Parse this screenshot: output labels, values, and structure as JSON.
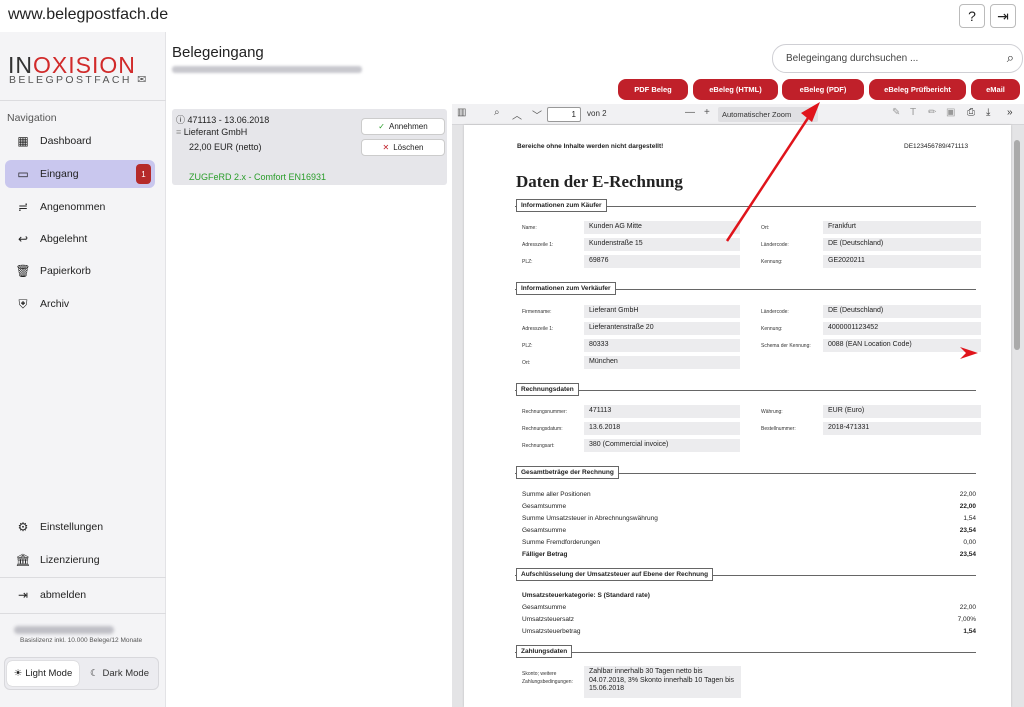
{
  "browser": {
    "url": "www.belegpostfach.de",
    "help_label": "?",
    "exit_label": "⇥"
  },
  "logo": {
    "line1_part1": "IN",
    "line1_part2": "OXISION",
    "line2": "BELEGPOSTFACH"
  },
  "sidebar": {
    "heading": "Navigation",
    "items": [
      {
        "label": "Dashboard",
        "icon": "dashboard-icon"
      },
      {
        "label": "Eingang",
        "icon": "inbox-icon",
        "badge": "1"
      },
      {
        "label": "Angenommen",
        "icon": "accepted-icon"
      },
      {
        "label": "Abgelehnt",
        "icon": "reply-icon"
      },
      {
        "label": "Papierkorb",
        "icon": "trash-icon"
      },
      {
        "label": "Archiv",
        "icon": "shield-icon"
      }
    ],
    "settings": "Einstellungen",
    "licensing": "Lizenzierung",
    "logout": "abmelden",
    "license_text": "Basislizenz inkl. 10.000 Belege/12 Monate",
    "light_mode": "Light Mode",
    "dark_mode": "Dark Mode"
  },
  "header": {
    "title": "Belegeingang",
    "search_placeholder": "Belegeingang durchsuchen ..."
  },
  "actions": [
    "PDF Beleg",
    "eBeleg (HTML)",
    "eBeleg (PDF)",
    "eBeleg Prüfbericht",
    "eMail"
  ],
  "document_item": {
    "id_date": "471113 - 13.06.2018",
    "sender": "Lieferant GmbH",
    "amount": "22,00 EUR (netto)",
    "format": "ZUGFeRD 2.x - Comfort EN16931",
    "accept": "Annehmen",
    "delete": "Löschen"
  },
  "viewer": {
    "page": "1",
    "of": "von 2",
    "zoom": "Automatischer Zoom"
  },
  "pdf": {
    "notice": "Bereiche ohne Inhalte werden nicht dargestellt!",
    "doc_id": "DE123456789/471113",
    "title": "Daten der E-Rechnung",
    "buyer": {
      "heading": "Informationen zum Käufer",
      "name_l": "Name:",
      "name": "Kunden AG Mitte",
      "addr_l": "Adresszeile 1:",
      "addr": "Kundenstraße 15",
      "plz_l": "PLZ:",
      "plz": "69876",
      "city_l": "Ort:",
      "city": "Frankfurt",
      "country_l": "Ländercode:",
      "country": "DE (Deutschland)",
      "id_l": "Kennung:",
      "id": "GE2020211"
    },
    "seller": {
      "heading": "Informationen zum Verkäufer",
      "name_l": "Firmenname:",
      "name": "Lieferant GmbH",
      "addr_l": "Adresszeile 1:",
      "addr": "Lieferantenstraße 20",
      "plz_l": "PLZ:",
      "plz": "80333",
      "city_l": "Ort:",
      "city": "München",
      "country_l": "Ländercode:",
      "country": "DE (Deutschland)",
      "id_l": "Kennung:",
      "id": "4000001123452",
      "scheme_l": "Schema der Kennung:",
      "scheme": "0088 (EAN Location Code)"
    },
    "invoice": {
      "heading": "Rechnungsdaten",
      "num_l": "Rechnungsnummer:",
      "num": "471113",
      "date_l": "Rechnungsdatum:",
      "date": "13.6.2018",
      "type_l": "Rechnungsart:",
      "type": "380 (Commercial invoice)",
      "cur_l": "Währung:",
      "cur": "EUR (Euro)",
      "order_l": "Bestellnummer:",
      "order": "2018-471331"
    },
    "totals": {
      "heading": "Gesamtbeträge der Rechnung",
      "rows": [
        {
          "l": "Summe aller Positionen",
          "v": "22,00",
          "b": false
        },
        {
          "l": "Gesamtsumme",
          "v": "22,00",
          "b": true
        },
        {
          "l": "Summe Umsatzsteuer in Abrechnungswährung",
          "v": "1,54",
          "b": false
        },
        {
          "l": "Gesamtsumme",
          "v": "23,54",
          "b": true
        },
        {
          "l": "Summe Fremdforderungen",
          "v": "0,00",
          "b": false
        },
        {
          "l": "Fälliger Betrag",
          "v": "23,54",
          "b": true
        }
      ]
    },
    "vat": {
      "heading": "Aufschlüsselung der Umsatzsteuer auf Ebene der Rechnung",
      "category": "Umsatzsteuerkategorie: S (Standard rate)",
      "rows": [
        {
          "l": "Gesamtsumme",
          "v": "22,00",
          "b": false
        },
        {
          "l": "Umsatzsteuersatz",
          "v": "7,00%",
          "b": false
        },
        {
          "l": "Umsatzsteuerbetrag",
          "v": "1,54",
          "b": true
        }
      ]
    },
    "payment": {
      "heading": "Zahlungsdaten",
      "label": "Skonto; weitere Zahlungsbedingungen:",
      "text": "Zahlbar innerhalb 30 Tagen netto bis 04.07.2018, 3% Skonto innerhalb 10 Tagen bis 15.06.2018"
    }
  }
}
